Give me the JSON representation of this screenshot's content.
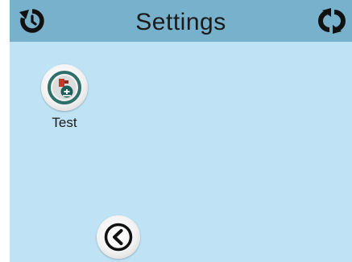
{
  "header": {
    "title": "Settings",
    "left_icon": "reset-icon",
    "right_icon": "refresh-icon",
    "background": "#78b1cb"
  },
  "apps": [
    {
      "label": "Test",
      "icon": "test-app-icon"
    }
  ],
  "footer": {
    "back_icon": "back-chevron-icon"
  },
  "colors": {
    "screen_background": "#bfe3f4",
    "icon_ring": "#2f6f6a",
    "icon_accent": "#c0392b"
  }
}
